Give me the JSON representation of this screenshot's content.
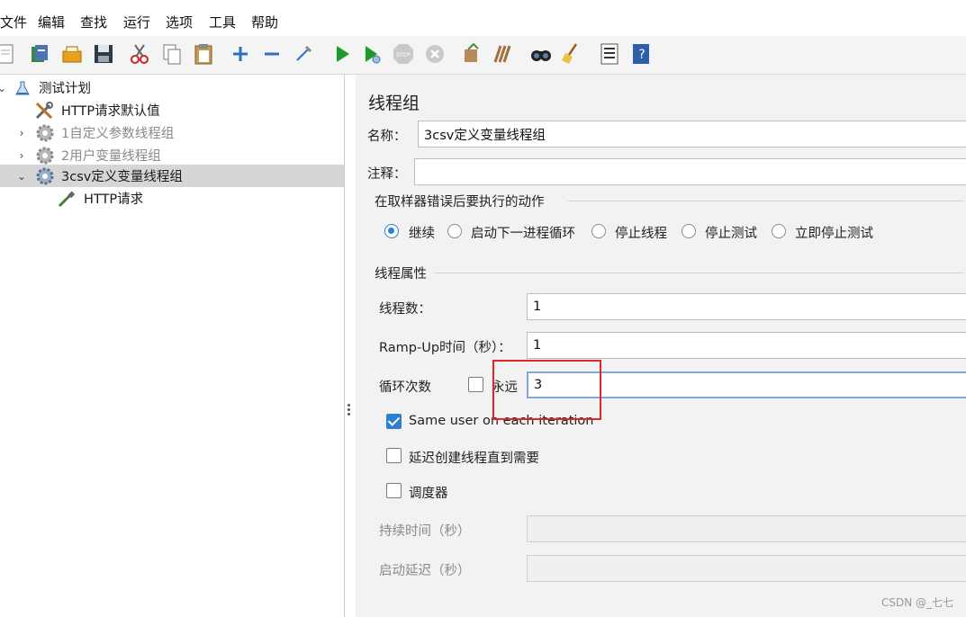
{
  "menubar": {
    "items": [
      "文件",
      "编辑",
      "查找",
      "运行",
      "选项",
      "工具",
      "帮助"
    ]
  },
  "toolbar": {
    "buttons": [
      "new-icon",
      "templates-icon",
      "open-icon",
      "save-icon",
      "cut-icon",
      "copy-icon",
      "paste-icon",
      "expand-icon",
      "collapse-icon",
      "toggle-icon",
      "start-icon",
      "start-no-pause-icon",
      "stop-icon",
      "shutdown-icon",
      "clear-icon",
      "clear-all-icon",
      "search-icon",
      "reset-search-icon",
      "function-helper-icon",
      "help-icon"
    ]
  },
  "tree": {
    "items": [
      {
        "label": "测试计划",
        "icon": "flask-icon"
      },
      {
        "label": "HTTP请求默认值",
        "icon": "wrench-icon"
      },
      {
        "label": "1自定义参数线程组",
        "icon": "gear-icon"
      },
      {
        "label": "2用户变量线程组",
        "icon": "gear-icon"
      },
      {
        "label": "3csv定义变量线程组",
        "icon": "gear-icon"
      },
      {
        "label": "HTTP请求",
        "icon": "pipette-icon"
      }
    ]
  },
  "panel": {
    "title": "线程组",
    "name_label": "名称：",
    "name_value": "3csv定义变量线程组",
    "comment_label": "注释：",
    "comment_value": "",
    "error_action": {
      "title": "在取样器错误后要执行的动作",
      "options": [
        "继续",
        "启动下一进程循环",
        "停止线程",
        "停止测试",
        "立即停止测试"
      ],
      "selected": "继续"
    },
    "thread_props": {
      "title": "线程属性",
      "threads_label": "线程数：",
      "threads_value": "1",
      "rampup_label": "Ramp-Up时间（秒）：",
      "rampup_value": "1",
      "loop_label": "循环次数",
      "forever_label": "永远",
      "forever_checked": false,
      "loop_value": "3",
      "same_user_label": "Same user on each iteration",
      "same_user_checked": true,
      "delay_label": "延迟创建线程直到需要",
      "delay_checked": false,
      "scheduler_label": "调度器",
      "scheduler_checked": false,
      "duration_label": "持续时间（秒）",
      "duration_value": "",
      "startup_delay_label": "启动延迟（秒）",
      "startup_delay_value": ""
    }
  },
  "watermark": "CSDN @_七七",
  "colors": {
    "accent": "#2d7fd2",
    "highlight": "#e0262b"
  }
}
